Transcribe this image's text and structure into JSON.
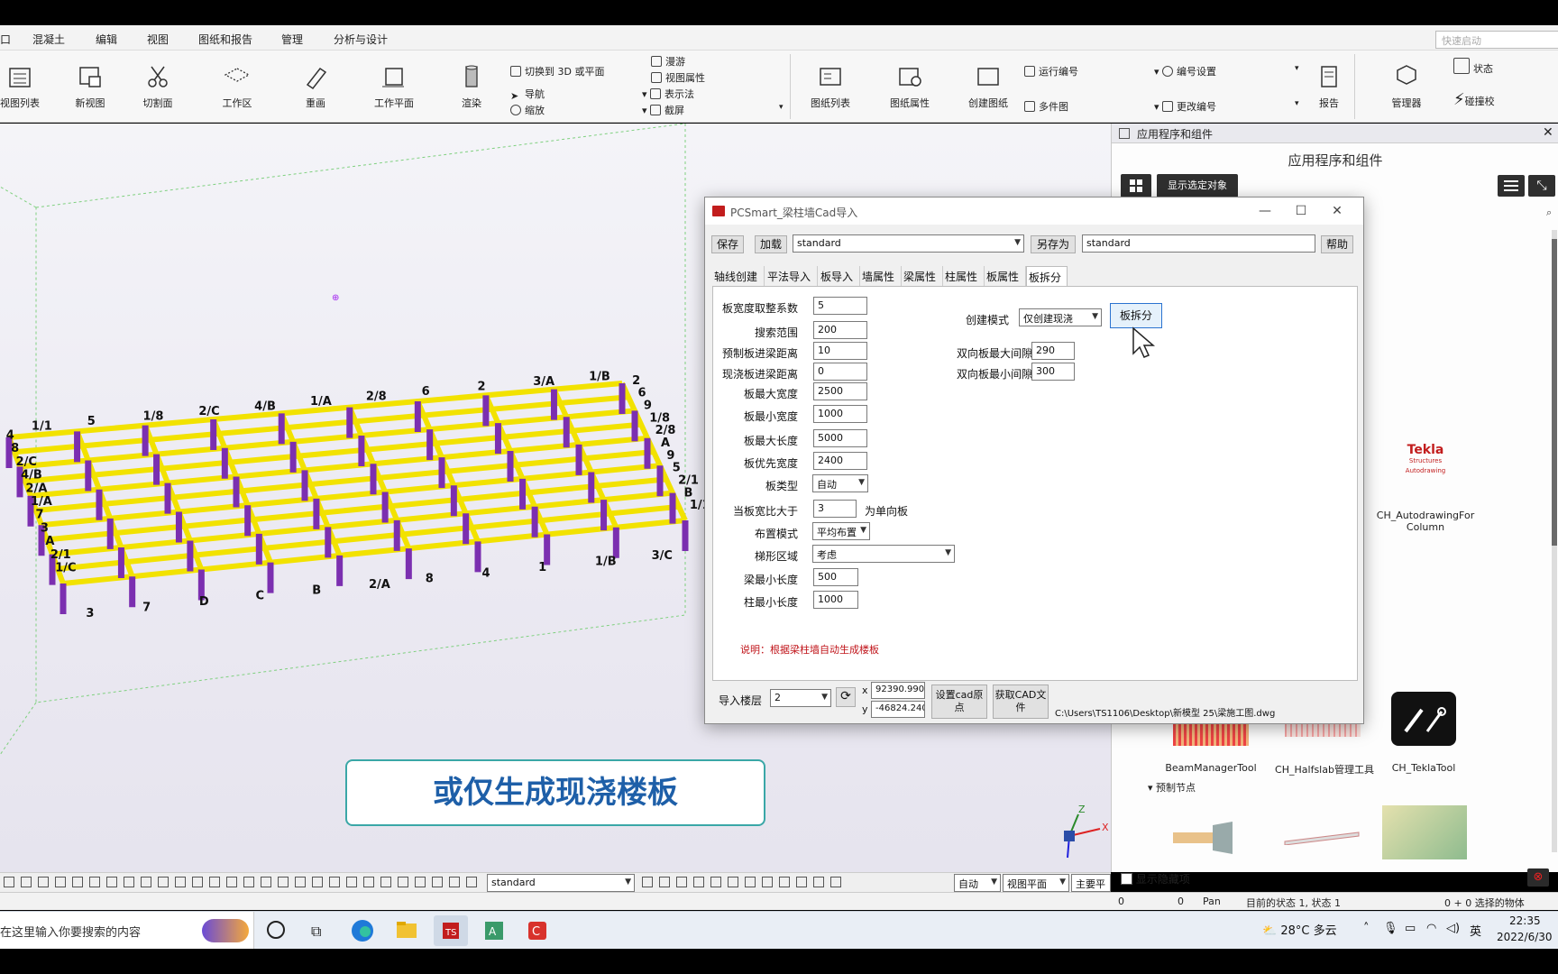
{
  "menu": {
    "tabs": [
      {
        "label": "混凝土"
      },
      {
        "label": "编辑"
      },
      {
        "label": "视图"
      },
      {
        "label": "图纸和报告"
      },
      {
        "label": "管理"
      },
      {
        "label": "分析与设计"
      }
    ],
    "quick_launch_placeholder": "快速启动"
  },
  "ribbon": {
    "large_buttons": [
      {
        "label": "视图列表",
        "icon": "view-list-icon"
      },
      {
        "label": "新视图",
        "icon": "new-view-icon"
      },
      {
        "label": "切割面",
        "icon": "scissors-icon"
      },
      {
        "label": "工作区",
        "icon": "work-area-icon"
      },
      {
        "label": "重画",
        "icon": "redraw-icon"
      },
      {
        "label": "工作平面",
        "icon": "work-plane-icon"
      },
      {
        "label": "渲染",
        "icon": "render-icon"
      },
      {
        "label": "图纸列表",
        "icon": "drawing-list-icon"
      },
      {
        "label": "图纸属性",
        "icon": "drawing-properties-icon"
      },
      {
        "label": "创建图纸",
        "icon": "create-drawing-icon"
      },
      {
        "label": "报告",
        "icon": "report-icon"
      },
      {
        "label": "管理器",
        "icon": "organizer-icon"
      }
    ],
    "small_buttons": [
      {
        "label": "切换到 3D 或平面"
      },
      {
        "label": "导航"
      },
      {
        "label": "缩放"
      },
      {
        "label": "漫游"
      },
      {
        "label": "视图属性"
      },
      {
        "label": "表示法"
      },
      {
        "label": "截屏"
      },
      {
        "label": "运行编号"
      },
      {
        "label": "多件图"
      },
      {
        "label": "编号设置"
      },
      {
        "label": "更改编号"
      },
      {
        "label": "状态"
      },
      {
        "label": "碰撞校"
      }
    ]
  },
  "viewport": {
    "caption": "或仅生成现浇楼板",
    "grid_labels": [
      "1/1",
      "2",
      "3",
      "4",
      "5",
      "6",
      "7",
      "8",
      "1/8",
      "9",
      "D",
      "2/C",
      "2/C",
      "1/8",
      "C",
      "4/B",
      "4/B",
      "2/8",
      "B",
      "2/A",
      "1/A",
      "A",
      "2/A",
      "1/A",
      "2/8",
      "9",
      "8",
      "7",
      "6",
      "5",
      "4",
      "3",
      "2",
      "2/1",
      "1",
      "A",
      "3/A",
      "B",
      "1/B",
      "2/1",
      "1/B",
      "1/1",
      "3/C",
      "1/C"
    ]
  },
  "dialog": {
    "title": "PCSmart_梁柱墙Cad导入",
    "save_label": "保存",
    "load_label": "加载",
    "preset_value": "standard",
    "save_as_label": "另存为",
    "save_as_value": "standard",
    "help_label": "帮助",
    "tabs": [
      {
        "label": "轴线创建"
      },
      {
        "label": "平法导入"
      },
      {
        "label": "板导入"
      },
      {
        "label": "墙属性"
      },
      {
        "label": "梁属性"
      },
      {
        "label": "柱属性"
      },
      {
        "label": "板属性"
      },
      {
        "label": "板拆分"
      }
    ],
    "fields": {
      "width_round_label": "板宽度取整系数",
      "width_round_value": "5",
      "search_range_label": "搜索范围",
      "search_range_value": "200",
      "precast_dist_label": "预制板进梁距离",
      "precast_dist_value": "10",
      "cast_dist_label": "现浇板进梁距离",
      "cast_dist_value": "0",
      "max_width_label": "板最大宽度",
      "max_width_value": "2500",
      "min_width_label": "板最小宽度",
      "min_width_value": "1000",
      "max_length_label": "板最大长度",
      "max_length_value": "5000",
      "pref_width_label": "板优先宽度",
      "pref_width_value": "2400",
      "slab_type_label": "板类型",
      "slab_type_value": "自动",
      "ratio_label": "当板宽比大于",
      "ratio_value": "3",
      "ratio_suffix": "为单向板",
      "layout_mode_label": "布置模式",
      "layout_mode_value": "平均布置",
      "trapezoid_label": "梯形区域",
      "trapezoid_value": "考虑",
      "beam_min_label": "梁最小长度",
      "beam_min_value": "500",
      "col_min_label": "柱最小长度",
      "col_min_value": "1000",
      "create_mode_label": "创建模式",
      "create_mode_value": "仅创建现浇",
      "split_button": "板拆分",
      "twoway_max_label": "双向板最大间隙",
      "twoway_max_value": "290",
      "twoway_min_label": "双向板最小间隙",
      "twoway_min_value": "300"
    },
    "note": "说明：根据梁柱墙自动生成楼板",
    "import_floor_label": "导入楼层",
    "import_floor_value": "2",
    "x_label": "x",
    "x_value": "92390.9901",
    "y_label": "y",
    "y_value": "-46824.2403",
    "set_origin_label": "设置cad原点",
    "get_file_label": "获取CAD文件",
    "file_path": "C:\\Users\\TS1106\\Desktop\\新模型 25\\梁施工图.dwg"
  },
  "side_panel": {
    "header": "应用程序和组件",
    "title": "应用程序和组件",
    "show_selected": "显示选定对象",
    "apps": [
      {
        "label": "CH_AutodrawingFor Column"
      },
      {
        "label": "BeamManagerTool"
      },
      {
        "label": "CH_Halfslab管理工具"
      },
      {
        "label": "CH_TeklaTool"
      }
    ],
    "section": "预制节点",
    "show_hidden": "显示隐藏项",
    "tekla_logo": "Tekla",
    "tekla_sub1": "Structures",
    "tekla_sub2": "Autodrawing"
  },
  "bottom_toolbar": {
    "combo1": "standard",
    "combo2": "自动",
    "combo3": "视图平面",
    "combo4": "主要平"
  },
  "status": {
    "v1": "0",
    "v2": "0",
    "mode": "Pan",
    "state": "目前的状态 1, 状态 1",
    "selection": "0 + 0 选择的物体"
  },
  "taskbar": {
    "search_placeholder": "在这里输入你要搜索的内容",
    "weather": "28°C 多云",
    "lang": "英",
    "time": "22:35",
    "date": "2022/6/30"
  }
}
